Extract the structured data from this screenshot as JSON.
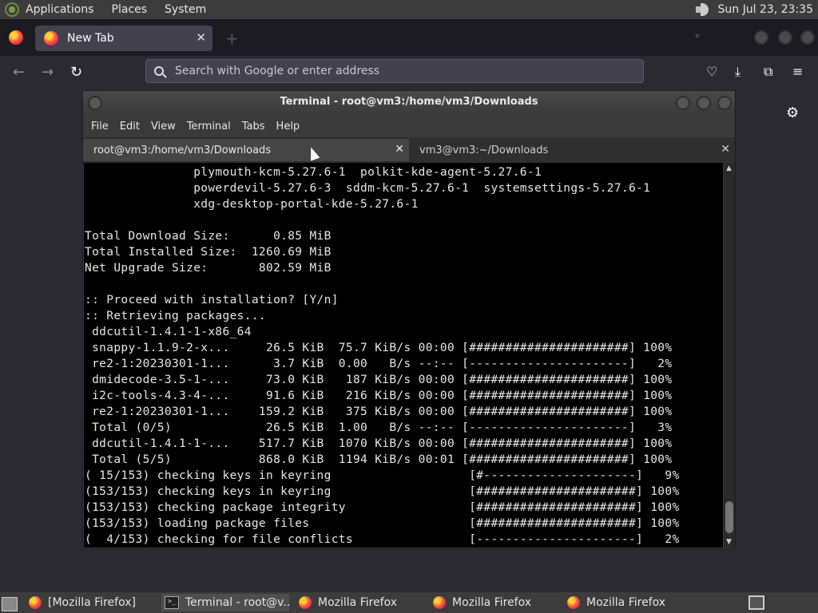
{
  "top_panel": {
    "menus": [
      "Applications",
      "Places",
      "System"
    ],
    "clock": "Sun Jul 23, 23:35"
  },
  "firefox": {
    "tab_title": "New Tab",
    "tab_close": "✕",
    "new_tab": "+",
    "url_placeholder": "Search with Google or enter address"
  },
  "terminal": {
    "title": "Terminal - root@vm3:/home/vm3/Downloads",
    "menus": [
      "File",
      "Edit",
      "View",
      "Terminal",
      "Tabs",
      "Help"
    ],
    "tabs": [
      {
        "label": "root@vm3:/home/vm3/Downloads",
        "close": "✕"
      },
      {
        "label": "vm3@vm3:~/Downloads",
        "close": "✕"
      }
    ],
    "lines": [
      "               plymouth-kcm-5.27.6-1  polkit-kde-agent-5.27.6-1",
      "               powerdevil-5.27.6-3  sddm-kcm-5.27.6-1  systemsettings-5.27.6-1",
      "               xdg-desktop-portal-kde-5.27.6-1",
      "",
      "Total Download Size:      0.85 MiB",
      "Total Installed Size:  1260.69 MiB",
      "Net Upgrade Size:       802.59 MiB",
      "",
      ":: Proceed with installation? [Y/n]",
      ":: Retrieving packages...",
      " ddcutil-1.4.1-1-x86_64",
      " snappy-1.1.9-2-x...     26.5 KiB  75.7 KiB/s 00:00 [######################] 100%",
      " re2-1:20230301-1...      3.7 KiB  0.00   B/s --:-- [----------------------]   2%",
      " dmidecode-3.5-1-...     73.0 KiB   187 KiB/s 00:00 [######################] 100%",
      " i2c-tools-4.3-4-...     91.6 KiB   216 KiB/s 00:00 [######################] 100%",
      " re2-1:20230301-1...    159.2 KiB   375 KiB/s 00:00 [######################] 100%",
      " Total (0/5)             26.5 KiB  1.00   B/s --:-- [----------------------]   3%",
      " ddcutil-1.4.1-1-...    517.7 KiB  1070 KiB/s 00:00 [######################] 100%",
      " Total (5/5)            868.0 KiB  1194 KiB/s 00:01 [######################] 100%",
      "( 15/153) checking keys in keyring                   [#---------------------]   9%",
      "(153/153) checking keys in keyring                   [######################] 100%",
      "(153/153) checking package integrity                 [######################] 100%",
      "(153/153) loading package files                      [######################] 100%",
      "(  4/153) checking for file conflicts                [----------------------]   2%"
    ]
  },
  "taskbar": {
    "items": [
      {
        "label": "[Mozilla Firefox]"
      },
      {
        "label": "Terminal - root@v..."
      },
      {
        "label": "Mozilla Firefox"
      },
      {
        "label": "Mozilla Firefox"
      },
      {
        "label": "Mozilla Firefox"
      }
    ]
  }
}
